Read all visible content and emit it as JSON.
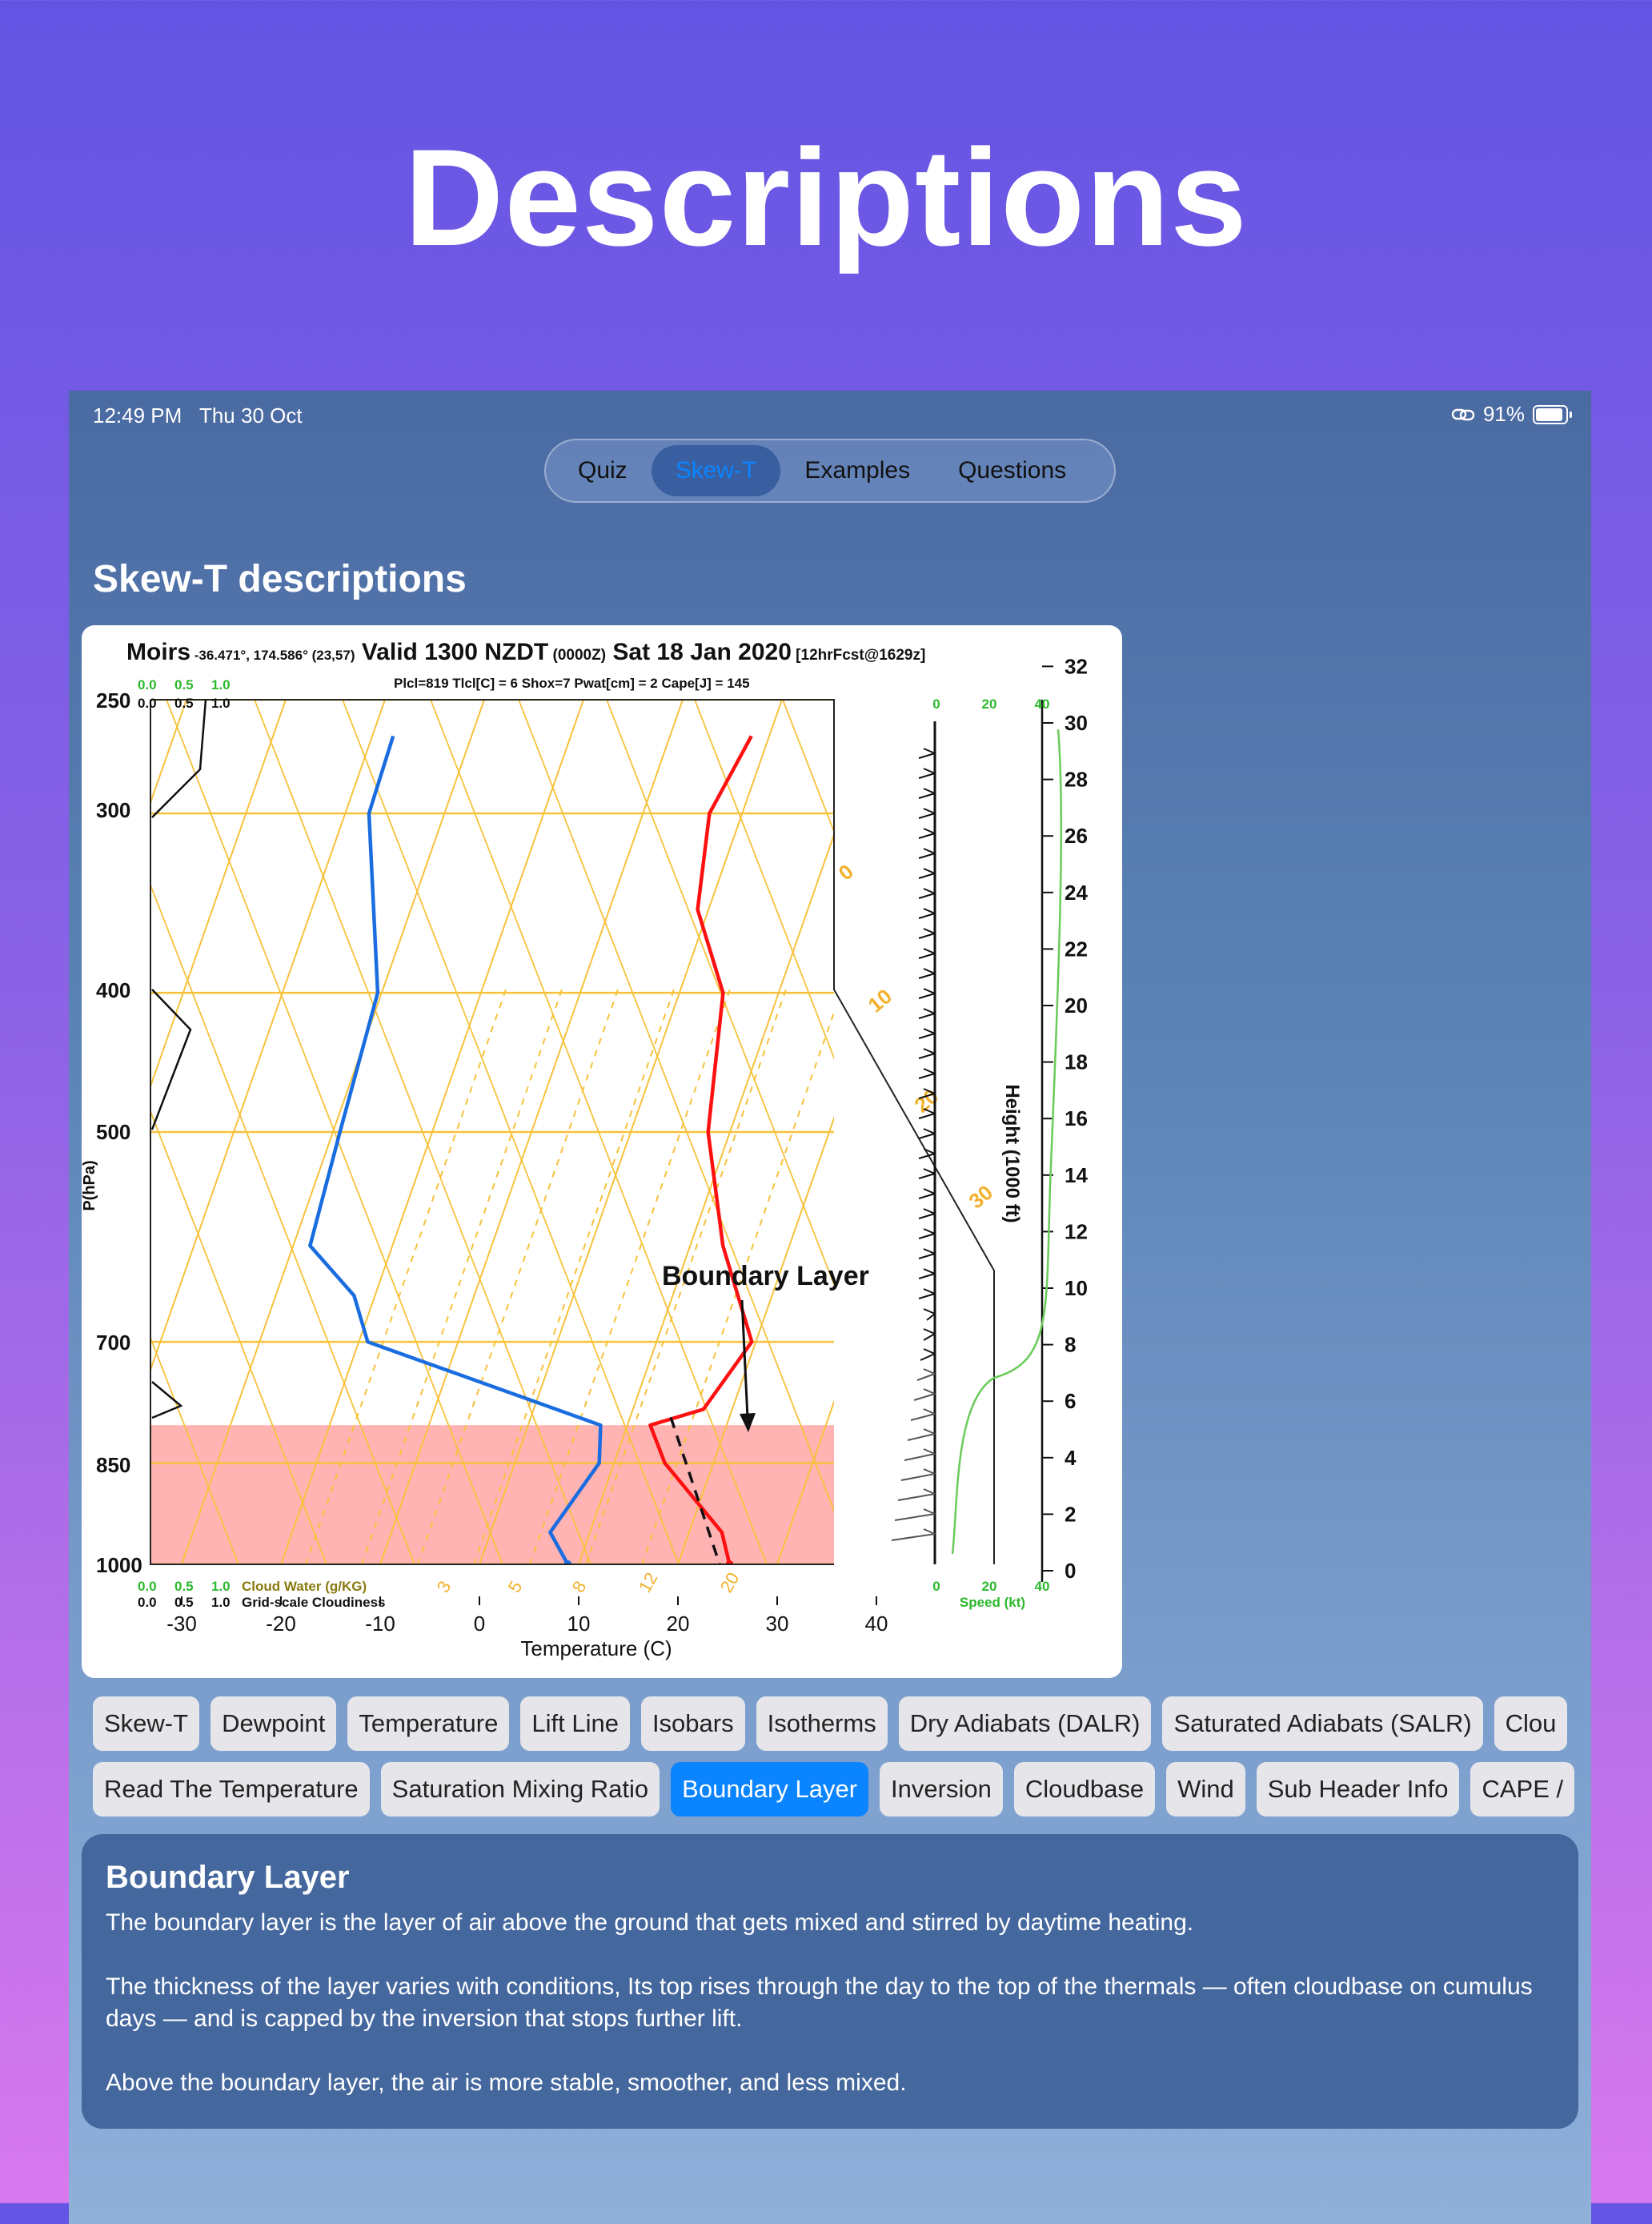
{
  "promo": {
    "title": "Descriptions"
  },
  "status": {
    "time": "12:49 PM",
    "date": "Thu 30 Oct",
    "battery": "91%",
    "battery_level": 0.91
  },
  "tabs": [
    {
      "label": "Quiz",
      "active": false
    },
    {
      "label": "Skew-T",
      "active": true
    },
    {
      "label": "Examples",
      "active": false
    },
    {
      "label": "Questions",
      "active": false
    }
  ],
  "section_title": "Skew-T descriptions",
  "chart_data": {
    "type": "skew-t",
    "header": {
      "station": "Moirs",
      "coords": "-36.471°, 174.586°",
      "grid": "(23,57)",
      "valid": "Valid 1300 NZDT",
      "utc": "(0000Z)",
      "date": "Sat 18 Jan 2020",
      "fcst": "[12hrFcst@1629z]",
      "subheader": "Plcl=819  Tlcl[C] = 6   Shox=7  Pwat[cm] = 2   Cape[J] = 145"
    },
    "ylabel": "P(hPa)",
    "xlabel": "Temperature (C)",
    "height_label": "Height (1000 ft)",
    "speed_label": "Speed (kt)",
    "pressure_ticks": [
      "250",
      "300",
      "400",
      "500",
      "700",
      "850",
      "1000"
    ],
    "temp_ticks": [
      "-30",
      "-20",
      "-10",
      "0",
      "10",
      "20",
      "30",
      "40"
    ],
    "height_ticks": [
      "0",
      "2",
      "4",
      "6",
      "8",
      "10",
      "12",
      "14",
      "16",
      "18",
      "20",
      "22",
      "24",
      "26",
      "28",
      "30",
      "32"
    ],
    "speed_ticks": [
      "0",
      "20",
      "40"
    ],
    "cloud_scale": [
      "0.0",
      "0.5",
      "1.0"
    ],
    "cloud_water_label": "Cloud Water (g/KG)",
    "cloudiness_label": "Grid-scale Cloudiness",
    "annotation": "Boundary Layer",
    "isotherm_labels": [
      "0",
      "10",
      "20",
      "30"
    ],
    "mixing_labels": [
      "3",
      "5",
      "8",
      "12",
      "20"
    ],
    "temperature_profile": [
      [
        -1.8,
        265
      ],
      [
        -3.3,
        300
      ],
      [
        -1.1,
        350
      ],
      [
        4.4,
        400
      ],
      [
        7.8,
        500
      ],
      [
        13.3,
        600
      ],
      [
        19.6,
        700
      ],
      [
        17.1,
        780
      ],
      [
        12.3,
        800
      ],
      [
        15.1,
        850
      ],
      [
        23.3,
        950
      ],
      [
        25.2,
        1000
      ]
    ],
    "dewpoint_profile": [
      [
        -37.9,
        265
      ],
      [
        -37.6,
        300
      ],
      [
        -30.4,
        400
      ],
      [
        -29.3,
        500
      ],
      [
        -28.3,
        600
      ],
      [
        -22.1,
        650
      ],
      [
        -19.1,
        700
      ],
      [
        7.3,
        800
      ],
      [
        8.5,
        850
      ],
      [
        6,
        950
      ],
      [
        8.9,
        1000
      ]
    ],
    "lift_line": [
      [
        14.1,
        790
      ],
      [
        24.2,
        1000
      ]
    ],
    "boundary_layer_top_hpa": 800,
    "cloud_colors": {
      "temperature": "#ff1010",
      "dewpoint": "#1a6de0",
      "grid": "#f7c23b",
      "boundary": "#ffb3b3"
    }
  },
  "chips_row1": [
    "Skew-T",
    "Dewpoint",
    "Temperature",
    "Lift Line",
    "Isobars",
    "Isotherms",
    "Dry Adiabats (DALR)",
    "Saturated Adiabats (SALR)",
    "Clou"
  ],
  "chips_row2": [
    "Read The Temperature",
    "Saturation Mixing Ratio",
    "Boundary Layer",
    "Inversion",
    "Cloudbase",
    "Wind",
    "Sub Header Info",
    "CAPE /"
  ],
  "active_chip": "Boundary Layer",
  "description": {
    "title": "Boundary Layer",
    "p1": "The boundary layer is the layer of air above the ground that gets mixed and stirred by daytime heating.",
    "p2": " The thickness of the layer varies with conditions, Its top rises through the day to the top of the thermals — often cloudbase on cumulus days — and is capped by the inversion that stops further lift.",
    "p3": "Above the boundary layer, the air is more stable, smoother, and less mixed."
  }
}
